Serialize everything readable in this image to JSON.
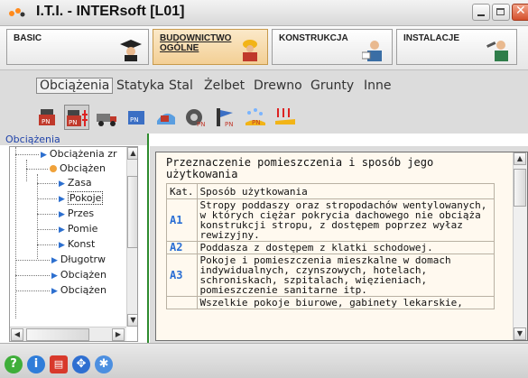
{
  "window": {
    "title": "I.T.I. - INTERsoft [L01]"
  },
  "modules": [
    {
      "label": "BASIC",
      "icon": "graduate-icon"
    },
    {
      "label": "BUDOWNICTWO\nOGÓLNE",
      "icon": "builder-icon"
    },
    {
      "label": "KONSTRUKCJA",
      "icon": "engineer-icon"
    },
    {
      "label": "INSTALACJE",
      "icon": "plumber-icon"
    }
  ],
  "categories": [
    "Obciążenia",
    "Statyka",
    "Stal",
    "Żelbet",
    "Drewno",
    "Grunty",
    "Inne"
  ],
  "toolbar_icons": [
    "pn-weight-icon",
    "pn-weight-arrows-icon",
    "truck-load-icon",
    "pn-box-icon",
    "wheel-pn-icon",
    "wind-pn-icon",
    "snow-pn-icon",
    "fire-arrows-icon"
  ],
  "section_label": "Obciążenia",
  "tree": {
    "nodes": [
      {
        "label": "Obciążenia zr"
      },
      {
        "label": "Obciążen"
      },
      {
        "label": "Zasa"
      },
      {
        "label": "Pokoje"
      },
      {
        "label": "Przes"
      },
      {
        "label": "Pomie"
      },
      {
        "label": "Konst"
      },
      {
        "label": "Długotrw"
      },
      {
        "label": "Obciążen"
      },
      {
        "label": "Obciążen"
      }
    ]
  },
  "panel": {
    "heading": "Przeznaczenie pomieszczenia i sposób jego użytkowania",
    "col_kat": "Kat.",
    "col_sposob": "Sposób użytkowania",
    "rows": [
      {
        "kat": "A1",
        "text": "Stropy poddaszy oraz stropodachów wentylowanych, w których ciężar pokrycia dachowego nie obciąża konstrukcji stropu, z dostępem poprzez wyłaz rewizyjny."
      },
      {
        "kat": "A2",
        "text": "Poddasza z dostępem z klatki schodowej."
      },
      {
        "kat": "A3",
        "text": "Pokoje i pomieszczenia mieszkalne w domach indywidualnych, czynszowych, hotelach, schroniskach, szpitalach, więzieniach, pomieszczenie sanitarne itp."
      },
      {
        "kat": "",
        "text": "Wszelkie pokoje biurowe, gabinety lekarskie,"
      }
    ]
  },
  "bottom_icons": [
    "help-icon",
    "info-icon",
    "print-icon",
    "navigate-icon",
    "tools-icon"
  ]
}
